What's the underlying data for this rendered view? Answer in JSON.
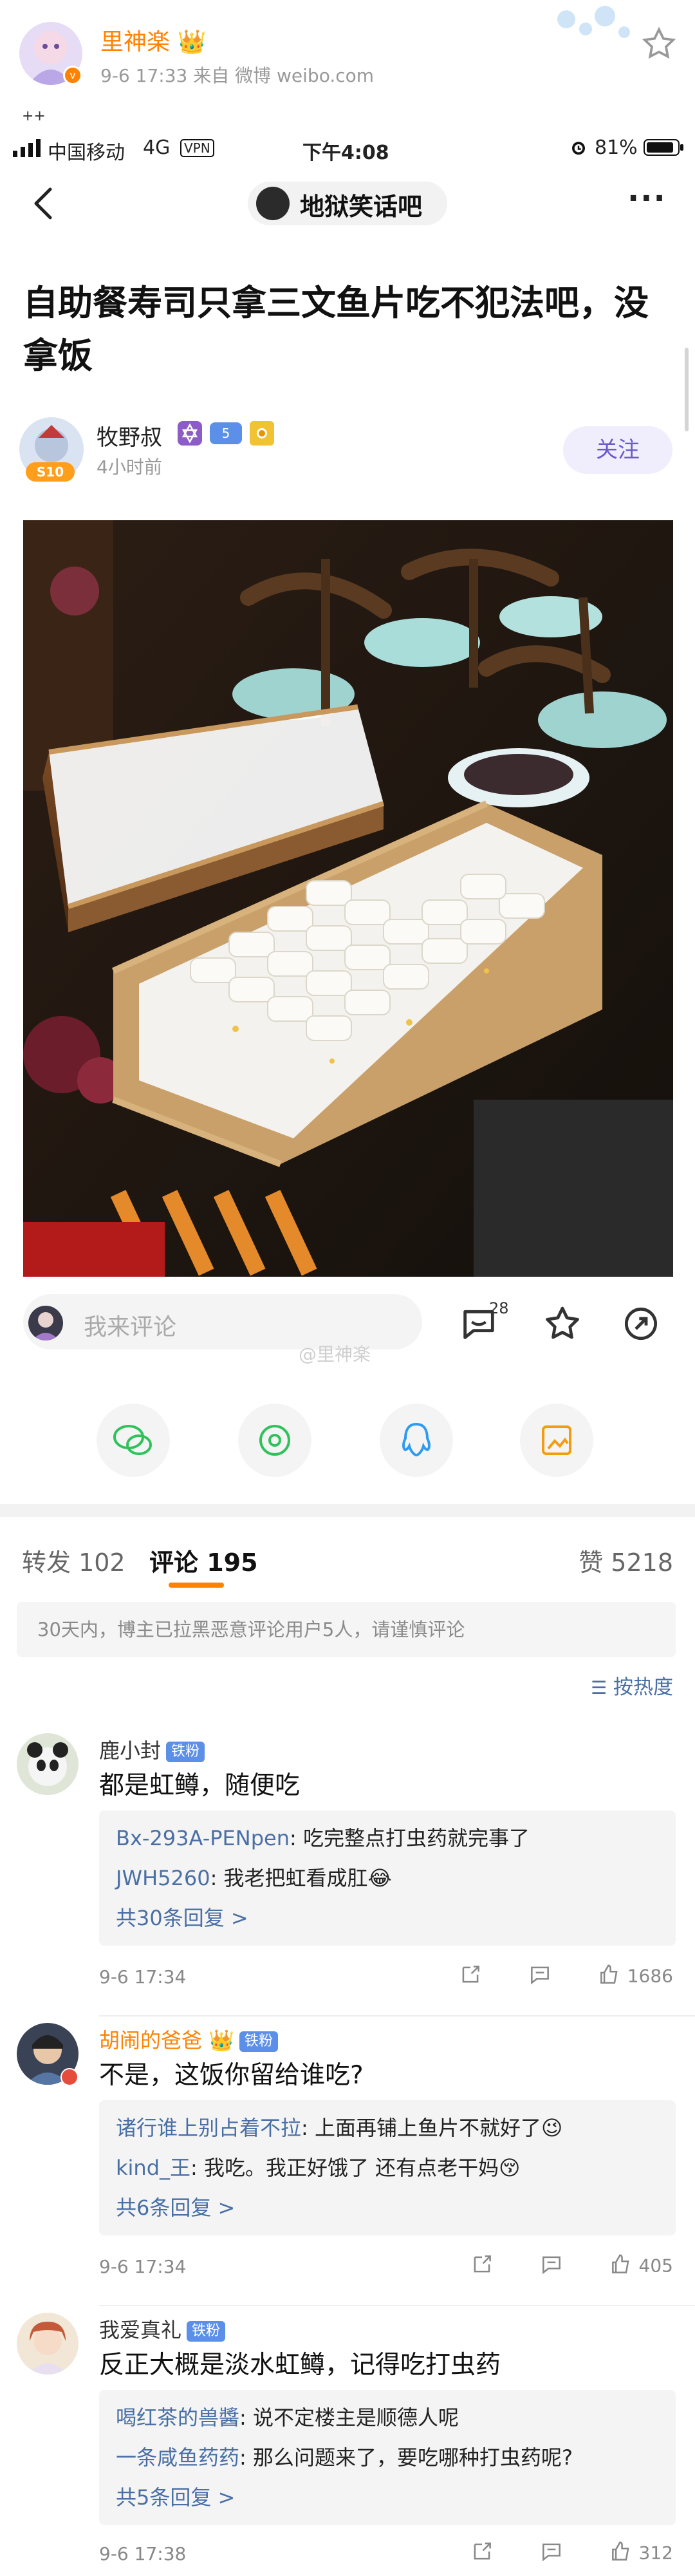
{
  "post_header": {
    "author": "里神楽",
    "meta": "9-6 17:33  来自 微博 weibo.com",
    "crown_glyph": "👑"
  },
  "status_bar": {
    "carrier": "中国移动",
    "network": "4G",
    "vpn": "VPN",
    "time": "下午4:08",
    "battery": "81%"
  },
  "nav": {
    "group_name": "地狱笑话吧",
    "more": "···"
  },
  "post": {
    "title": "自助餐寿司只拿三文鱼片吃不犯法吧，没拿饭",
    "author": "牧野叔",
    "level_badge": "5",
    "avatar_badge": "S10",
    "time": "4小时前",
    "follow_label": "关注"
  },
  "action_bar": {
    "comment_placeholder": "我来评论",
    "comment_count": "28",
    "watermark": "@里神楽"
  },
  "tabs": {
    "repost": "转发 102",
    "comment": "评论 195",
    "like": "赞 5218"
  },
  "notice": "30天内，博主已拉黑恶意评论用户5人，请谨慎评论",
  "sort_label": "按热度",
  "comments": [
    {
      "user": "鹿小封",
      "badge": "铁粉",
      "text": "都是虹鳟，随便吃",
      "replies": [
        {
          "user": "Bx-293A-PENpen",
          "text": ": 吃完整点打虫药就完事了"
        },
        {
          "user": "JWH5260",
          "text": ": 我老把虹看成肛😂"
        }
      ],
      "more": "共30条回复 >",
      "time": "9-6 17:34",
      "likes": "1686"
    },
    {
      "user": "胡闹的爸爸",
      "badge": "铁粉",
      "text": "不是，这饭你留给谁吃?",
      "replies": [
        {
          "user": "诸行谁上别占着不拉",
          "text": ": 上面再铺上鱼片不就好了😉"
        },
        {
          "user": "kind_王",
          "text": ": 我吃。我正好饿了 还有点老干妈😚"
        }
      ],
      "more": "共6条回复 >",
      "time": "9-6 17:34",
      "likes": "405"
    },
    {
      "user": "我爱真礼",
      "badge": "铁粉",
      "text": "反正大概是淡水虹鳟，记得吃打虫药",
      "replies": [
        {
          "user": "喝红茶的兽醬",
          "text": ": 说不定楼主是顺德人呢"
        },
        {
          "user": "一条咸鱼药药",
          "text": ": 那么问题来了，要吃哪种打虫药呢?"
        }
      ],
      "more": "共5条回复 >",
      "time": "9-6 17:38",
      "likes": "312"
    }
  ],
  "colors": {
    "link_blue": "#4a6fa5",
    "accent_orange": "#ff8200",
    "follow_purple": "#6a5acd"
  }
}
